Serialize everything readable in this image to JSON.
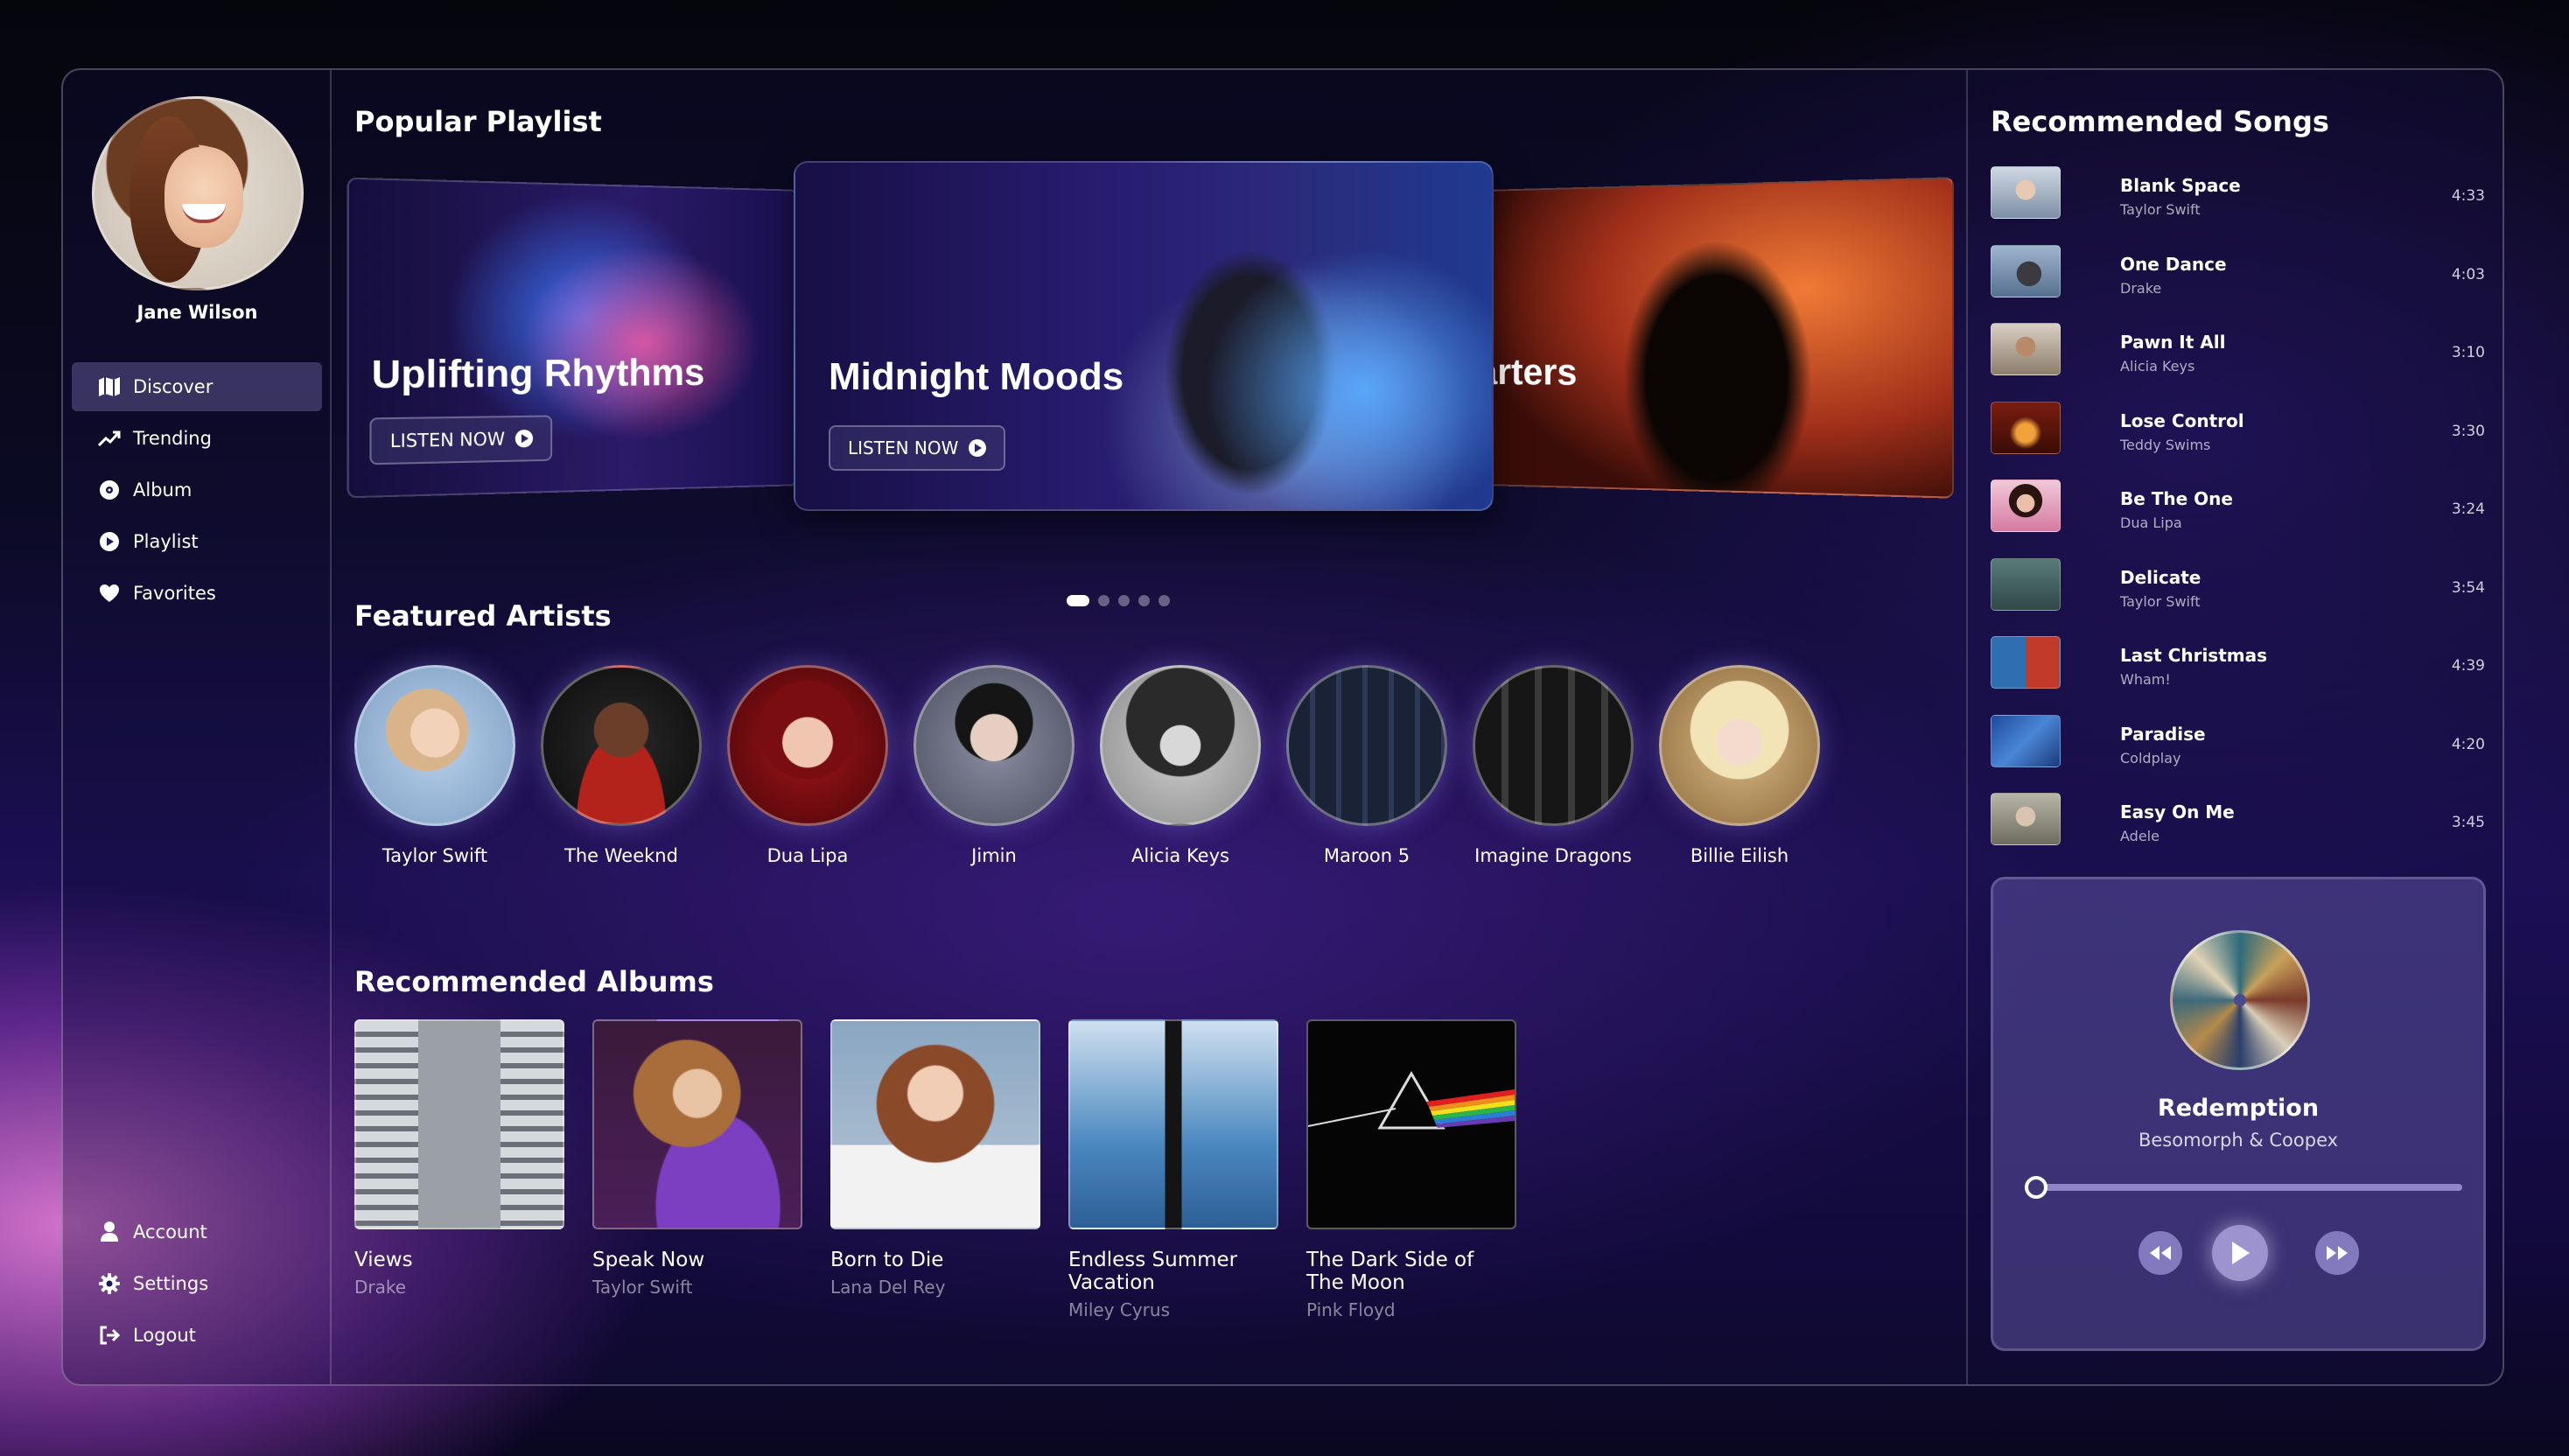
{
  "user": {
    "name": "Jane Wilson"
  },
  "nav": {
    "items": [
      {
        "label": "Discover",
        "icon": "map-icon",
        "active": true
      },
      {
        "label": "Trending",
        "icon": "trending-icon"
      },
      {
        "label": "Album",
        "icon": "disc-icon"
      },
      {
        "label": "Playlist",
        "icon": "play-circle-icon"
      },
      {
        "label": "Favorites",
        "icon": "heart-icon"
      }
    ],
    "bottom": [
      {
        "label": "Account",
        "icon": "user-icon"
      },
      {
        "label": "Settings",
        "icon": "gear-icon"
      },
      {
        "label": "Logout",
        "icon": "logout-icon"
      }
    ]
  },
  "popular": {
    "title": "Popular Playlist",
    "cards": [
      {
        "title": "Uplifting Rhythms",
        "button": "LISTEN NOW"
      },
      {
        "title": "Midnight Moods",
        "button": "LISTEN NOW"
      },
      {
        "title": "arters"
      }
    ],
    "active_dot": 0,
    "dot_count": 5
  },
  "artists": {
    "title": "Featured Artists",
    "items": [
      "Taylor Swift",
      "The Weeknd",
      "Dua Lipa",
      "Jimin",
      "Alicia Keys",
      "Maroon 5",
      "Imagine Dragons",
      "Billie Eilish"
    ]
  },
  "albums": {
    "title": "Recommended Albums",
    "items": [
      {
        "title": "Views",
        "artist": "Drake"
      },
      {
        "title": "Speak Now",
        "artist": "Taylor Swift"
      },
      {
        "title": "Born to Die",
        "artist": "Lana Del Rey"
      },
      {
        "title": "Endless Summer Vacation",
        "artist": "Miley Cyrus"
      },
      {
        "title": "The Dark Side of The Moon",
        "artist": "Pink Floyd"
      }
    ]
  },
  "songs": {
    "title": "Recommended Songs",
    "items": [
      {
        "title": "Blank Space",
        "artist": "Taylor Swift",
        "duration": "4:33"
      },
      {
        "title": "One Dance",
        "artist": "Drake",
        "duration": "4:03"
      },
      {
        "title": "Pawn It All",
        "artist": "Alicia Keys",
        "duration": "3:10"
      },
      {
        "title": "Lose Control",
        "artist": "Teddy Swims",
        "duration": "3:30"
      },
      {
        "title": "Be The One",
        "artist": "Dua Lipa",
        "duration": "3:24"
      },
      {
        "title": "Delicate",
        "artist": "Taylor Swift",
        "duration": "3:54"
      },
      {
        "title": "Last Christmas",
        "artist": "Wham!",
        "duration": "4:39"
      },
      {
        "title": "Paradise",
        "artist": "Coldplay",
        "duration": "4:20"
      },
      {
        "title": "Easy On Me",
        "artist": "Adele",
        "duration": "3:45"
      }
    ]
  },
  "player": {
    "title": "Redemption",
    "artist": "Besomorph & Coopex",
    "progress": 0.0
  }
}
